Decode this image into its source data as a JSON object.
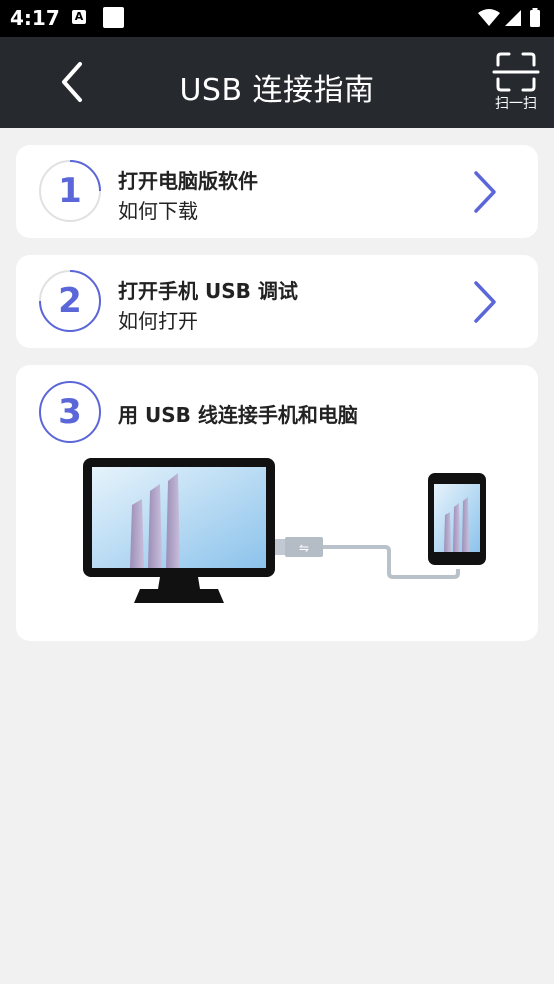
{
  "status_bar": {
    "time": "4:17",
    "icons": [
      "a-notification-icon",
      "square-notification-icon",
      "wifi-icon",
      "signal-icon",
      "battery-icon"
    ]
  },
  "app_bar": {
    "title": "USB 连接指南",
    "scan_label": "扫一扫"
  },
  "steps": [
    {
      "number": "1",
      "title": "打开电脑版软件",
      "subtitle": "如何下载"
    },
    {
      "number": "2",
      "title": "打开手机 USB 调试",
      "subtitle": "如何打开"
    },
    {
      "number": "3",
      "title": "用 USB 线连接手机和电脑"
    }
  ],
  "colors": {
    "accent": "#5b67d8",
    "app_bar": "#262a2f",
    "background": "#f1f1f1"
  }
}
